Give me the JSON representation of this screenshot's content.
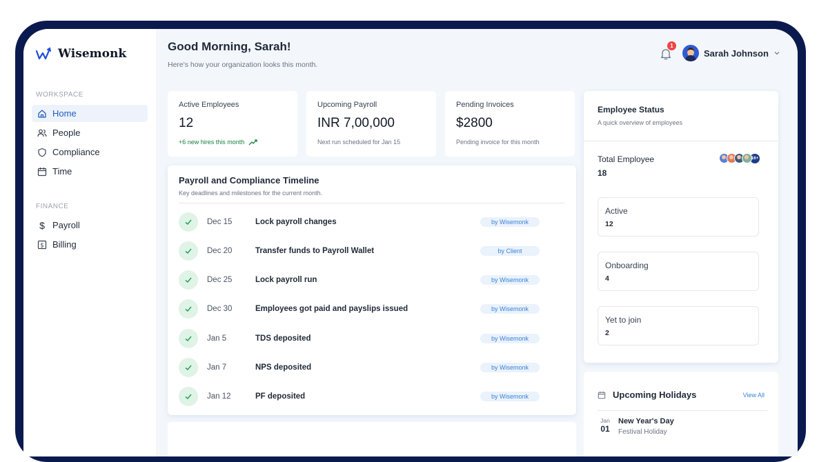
{
  "app": {
    "brand": "Wisemonk"
  },
  "sidebar": {
    "workspace_label": "WORKSPACE",
    "finance_label": "FINANCE",
    "items": [
      {
        "label": "Home",
        "icon": "home-icon"
      },
      {
        "label": "People",
        "icon": "people-icon"
      },
      {
        "label": "Compliance",
        "icon": "shield-icon"
      },
      {
        "label": "Time",
        "icon": "calendar-icon"
      },
      {
        "label": "Payroll",
        "icon": "dollar-icon"
      },
      {
        "label": "Billing",
        "icon": "billing-icon"
      }
    ],
    "active": "Home"
  },
  "header": {
    "greeting": "Good Morning, Sarah!",
    "subtitle": "Here's how your organization looks this month.",
    "notification_count": "1",
    "user_name": "Sarah Johnson"
  },
  "stats": [
    {
      "title": "Active Employees",
      "value": "12",
      "sub": "+6 new hires this month"
    },
    {
      "title": "Upcoming Payroll",
      "value": "INR 7,00,000",
      "sub": "Next run scheduled for Jan 15"
    },
    {
      "title": "Pending Invoices",
      "value": "$2800",
      "sub": "Pending invoice for this month"
    }
  ],
  "timeline": {
    "title": "Payroll and Compliance Timeline",
    "subtitle": "Key deadlines and milestones for the current month.",
    "rows": [
      {
        "date": "Dec 15",
        "event": "Lock payroll changes",
        "owner": "by Wisemonk"
      },
      {
        "date": "Dec 20",
        "event": "Transfer funds to Payroll Wallet",
        "owner": "by Client"
      },
      {
        "date": "Dec 25",
        "event": "Lock payroll run",
        "owner": "by Wisemonk"
      },
      {
        "date": "Dec 30",
        "event": "Employees got paid and payslips issued",
        "owner": "by Wisemonk"
      },
      {
        "date": "Jan 5",
        "event": "TDS deposited",
        "owner": "by Wisemonk"
      },
      {
        "date": "Jan 7",
        "event": "NPS deposited",
        "owner": "by Wisemonk"
      },
      {
        "date": "Jan 12",
        "event": "PF deposited",
        "owner": "by Wisemonk"
      }
    ]
  },
  "employee_status": {
    "title": "Employee Status",
    "subtitle": "A quick overview of employees",
    "total_label": "Total Employee",
    "total_value": "18",
    "more_badge": "16+",
    "statuses": [
      {
        "label": "Active",
        "value": "12"
      },
      {
        "label": "Onboarding",
        "value": "4"
      },
      {
        "label": "Yet to join",
        "value": "2"
      }
    ]
  },
  "holidays": {
    "title": "Upcoming Holidays",
    "view_all": "View All",
    "items": [
      {
        "month": "Jan",
        "day": "01",
        "name": "New Year's Day",
        "type": "Festival Holiday"
      }
    ]
  },
  "colors": {
    "accent": "#1d5fbf",
    "frame": "#0b1a4e",
    "success": "#15803d",
    "badge_text": "#3b82d6",
    "notification": "#ef4444"
  }
}
